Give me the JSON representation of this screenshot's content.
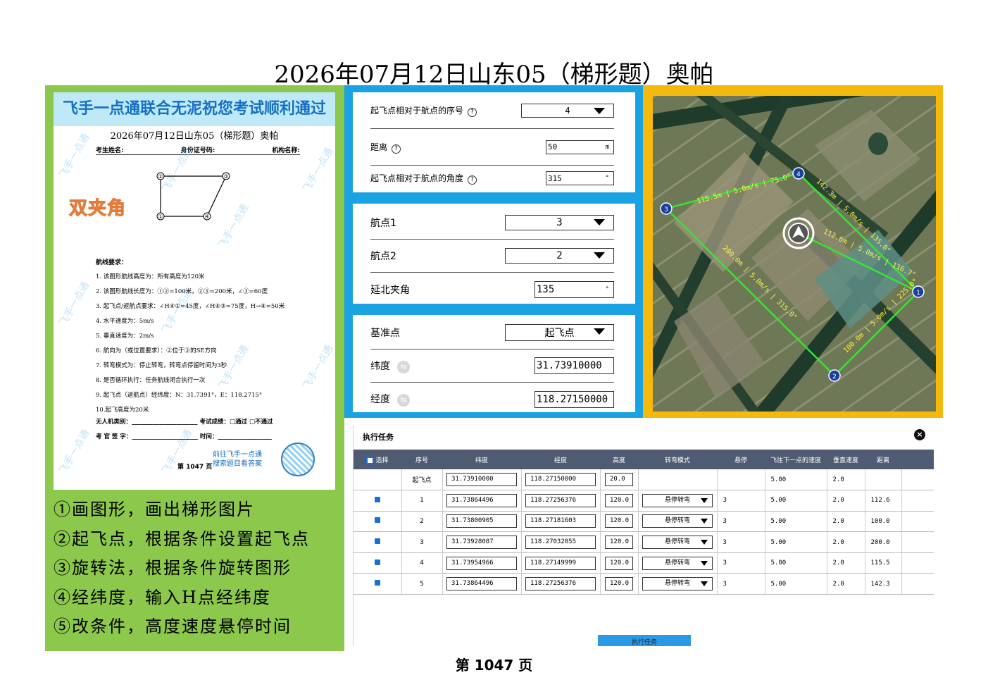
{
  "page_title": "2026年07月12日山东05（梯形题）奥帕",
  "paper": {
    "banner": "飞手一点通联合无泥祝您考试顺利通过",
    "subtitle": "2026年07月12日山东05（梯形题）奥帕",
    "info": [
      "考生姓名:",
      "身份证号码:",
      "机构名称:"
    ],
    "stamp": "双夹角",
    "points": [
      "②",
      "③",
      "①",
      "④"
    ],
    "req_title": "航线要求：",
    "requirements": [
      "1.  该图形航线高度为：所有高度为120米",
      "2.  该图形航线长度为：①②=100米，②③=200米，∠③=60度",
      "3.  起飞点/返航点要求：∠H④①=45度，∠H④③=75度，H→④=50米",
      "4.  水平速度为：5m/s",
      "5.  垂直速度为：2m/s",
      "6.  航向为（或位置要求）：②位于③的SE方向",
      "7.  转弯模式为：停止转弯，转弯点停留时间为3秒",
      "8.  是否循环执行：任务航线闭合执行一次",
      "9.  起飞点（返航点）经纬度：N：31.7391°，E：118.2715°",
      "10.起飞高度为20米"
    ],
    "sign": [
      "无人机类别：______________________   考试成绩：□通过   □不通过",
      "考 官 签 字：______________________   时间：__________________"
    ],
    "goto": [
      "前往飞手一点通",
      "搜索题目看答案"
    ],
    "page": "第 1047 页",
    "watermark": "飞手一点通"
  },
  "steps": [
    "①画图形，画出梯形图片",
    "②起飞点，根据条件设置起飞点",
    "③旋转法，根据条件旋转图形",
    "④经纬度，输入H点经纬度",
    "⑤改条件，高度速度悬停时间"
  ],
  "settings_card1": {
    "seq_label": "起飞点相对于航点的序号",
    "seq_value": "4",
    "dist_label": "距离",
    "dist_value": "50",
    "dist_unit": "m",
    "angle_label": "起飞点相对于航点的角度",
    "angle_value": "315",
    "angle_unit": "°"
  },
  "settings_card2": {
    "wp1_label": "航点1",
    "wp1_value": "3",
    "wp2_label": "航点2",
    "wp2_value": "2",
    "north_label": "延北夹角",
    "north_value": "135",
    "north_unit": "°"
  },
  "settings_card3": {
    "ref_label": "基准点",
    "ref_value": "起飞点",
    "lat_label": "纬度",
    "lat_value": "31.73910000",
    "lon_label": "经度",
    "lon_value": "118.27150000"
  },
  "map": {
    "waypoints": [
      "1",
      "2",
      "3",
      "4"
    ],
    "edge_labels": [
      "115.5m | 5.0m/s | 75.0°",
      "142.3m | 5.0m/s | 135.0°",
      "112.6m | 5.0m/s | 116.7°",
      "200.0m | 5.0m/s | 315.0°",
      "100.0m | 5.0m/s | 225.0°"
    ]
  },
  "task": {
    "title": "执行任务",
    "close": "×",
    "headers": [
      "选择",
      "序号",
      "纬度",
      "经度",
      "高度",
      "转弯模式",
      "悬停",
      "飞往下一点的速度",
      "垂直速度",
      "距离"
    ],
    "rows": [
      {
        "seq": "起飞点",
        "lat": "31.73910000",
        "lon": "118.27150000",
        "alt": "20.0",
        "mode": "",
        "hover": "",
        "speed": "5.00",
        "vspeed": "2.0",
        "dist": ""
      },
      {
        "seq": "1",
        "lat": "31.73864496",
        "lon": "118.27256376",
        "alt": "120.0",
        "mode": "悬停转弯",
        "hover": "3",
        "speed": "5.00",
        "vspeed": "2.0",
        "dist": "112.6"
      },
      {
        "seq": "2",
        "lat": "31.73800905",
        "lon": "118.27181603",
        "alt": "120.0",
        "mode": "悬停转弯",
        "hover": "3",
        "speed": "5.00",
        "vspeed": "2.0",
        "dist": "100.0"
      },
      {
        "seq": "3",
        "lat": "31.73928087",
        "lon": "118.27032055",
        "alt": "120.0",
        "mode": "悬停转弯",
        "hover": "3",
        "speed": "5.00",
        "vspeed": "2.0",
        "dist": "200.0"
      },
      {
        "seq": "4",
        "lat": "31.73954966",
        "lon": "118.27149999",
        "alt": "120.0",
        "mode": "悬停转弯",
        "hover": "3",
        "speed": "5.00",
        "vspeed": "2.0",
        "dist": "115.5"
      },
      {
        "seq": "5",
        "lat": "31.73864496",
        "lon": "118.27256376",
        "alt": "120.0",
        "mode": "悬停转弯",
        "hover": "3",
        "speed": "5.00",
        "vspeed": "2.0",
        "dist": "142.3"
      }
    ],
    "exec_button": "执行任务"
  },
  "footer": "第 1047 页",
  "colors": {
    "green_panel": "#8cc84b",
    "blue_panel": "#1ba2e2",
    "map_frame": "#f5b80d",
    "route": "#33e633",
    "table_header": "#4f5b73"
  }
}
